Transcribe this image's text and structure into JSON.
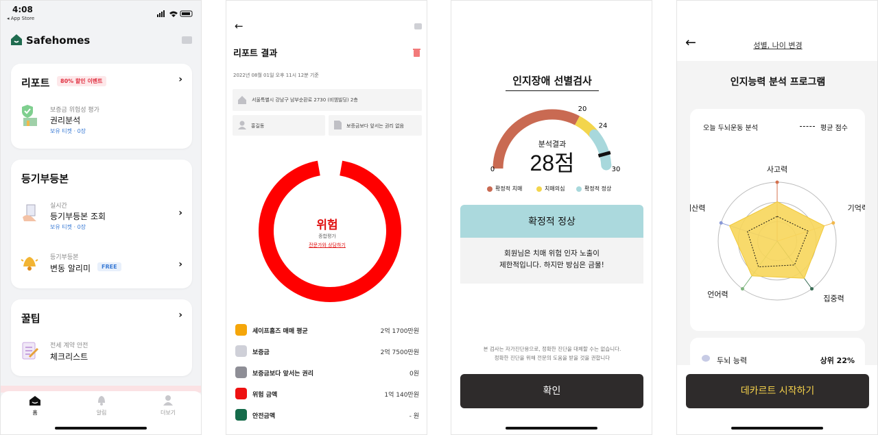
{
  "screen1": {
    "status_time": "4:08",
    "status_back": "◂ App Store",
    "brand": "Safehomes",
    "report_card": {
      "title": "리포트",
      "promo": "80% 할인 이벤트",
      "sub": "보증금 위험성 평가",
      "item": "권리분석",
      "ticket": "보유 티켓 · 0장"
    },
    "registry_card": {
      "title": "등기부등본",
      "sub1": "실시간",
      "item1": "등기부등본 조회",
      "ticket1": "보유 티켓 · 0장",
      "sub2": "등기부등본",
      "item2": "변동 알리미",
      "free": "FREE"
    },
    "tips_card": {
      "title": "꿀팁",
      "sub": "전세 계약 안전",
      "item": "체크리스트"
    },
    "tabs": [
      "홈",
      "알림",
      "더보기"
    ]
  },
  "screen2": {
    "title": "리포트 결과",
    "timestamp": "2022년 08월 01일 오후 11시 12분 기준",
    "address": "서울특별시 강남구 남부순환로 2730 (비엠빌딩) 2층",
    "owner": "홍길동",
    "rights": "보증금보다 앞서는 권리 없음",
    "risk_label": "위험",
    "risk_sub": "종합평가",
    "risk_link": "전문가와 상담하기",
    "legend": [
      {
        "label": "세이프홈즈 매매 평균",
        "value": "2억 1700만원",
        "color": "#f5a60a"
      },
      {
        "label": "보증금",
        "value": "2억 7500만원",
        "color": "#cfd0d8"
      },
      {
        "label": "보증금보다 앞서는 권리",
        "value": "0원",
        "color": "#8e8e96"
      },
      {
        "label": "위험 금액",
        "value": "1억 140만원",
        "color": "#ee1111"
      },
      {
        "label": "안전금액",
        "value": "- 원",
        "color": "#156b4a"
      }
    ],
    "donut_color": "#ff0000"
  },
  "screen3": {
    "title": "인지장애 선별검사",
    "gauge": {
      "min": 0,
      "max": 30,
      "t1": 20,
      "t2": 24,
      "score": 28
    },
    "tick_labels": [
      "0",
      "20",
      "24",
      "30"
    ],
    "score_label": "분석결과",
    "score_text": "28점",
    "legend": [
      {
        "label": "확정적 치매",
        "color": "#c96a52"
      },
      {
        "label": "치매의심",
        "color": "#f3d54c"
      },
      {
        "label": "확정적 정상",
        "color": "#a8d8dc"
      }
    ],
    "result_title": "확정적 정상",
    "result_body_1": "회원님은 치매 위험 인자 노출이",
    "result_body_2": "제한적입니다. 하지만 방심은 금물!",
    "disclaimer_1": "본 검사는 자가진단용으로, 정확한 진단을 대체할 수는 없습니다.",
    "disclaimer_2": "정확한 진단을 위해 전문의 도움을 받을 것을 권합니다",
    "confirm": "확인"
  },
  "screen4": {
    "header_link": "성별, 나이 변경",
    "title": "인지능력 분석 프로그램",
    "chart_label": "오늘 두뇌운동 분석",
    "avg_label": "평균 점수",
    "axes": [
      "사고력",
      "기억력",
      "집중력",
      "언어력",
      "계산력"
    ],
    "axis_colors": [
      "#d4714e",
      "#f2b84b",
      "#3b6e57",
      "#7fb57f",
      "#8a9ad8"
    ],
    "brain_label": "두뇌 능력",
    "brain_value": "상위 22%",
    "start": "데카르트 시작하기"
  },
  "chart_data": {
    "type": "radar",
    "categories": [
      "사고력",
      "기억력",
      "집중력",
      "언어력",
      "계산력"
    ],
    "series": [
      {
        "values": [
          0.67,
          0.84,
          0.78,
          0.73,
          0.85
        ]
      },
      {
        "name": "평균 점수",
        "values": [
          0.42,
          0.55,
          0.5,
          0.54,
          0.53
        ]
      }
    ],
    "range": [
      0,
      1
    ]
  }
}
